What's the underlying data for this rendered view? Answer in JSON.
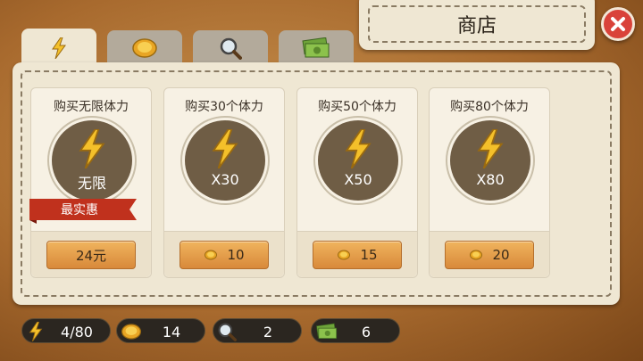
{
  "header": {
    "title": "商店"
  },
  "tabs": [
    {
      "icon": "lightning-icon",
      "active": true
    },
    {
      "icon": "coin-icon",
      "active": false
    },
    {
      "icon": "magnifier-icon",
      "active": false
    },
    {
      "icon": "cash-icon",
      "active": false
    }
  ],
  "cards": [
    {
      "title": "购买无限体力",
      "amount": "无限",
      "badge": "最实惠",
      "price": "24元",
      "price_icon": ""
    },
    {
      "title": "购买30个体力",
      "amount": "X30",
      "badge": "",
      "price": "10",
      "price_icon": "coin-icon"
    },
    {
      "title": "购买50个体力",
      "amount": "X50",
      "badge": "",
      "price": "15",
      "price_icon": "coin-icon"
    },
    {
      "title": "购买80个体力",
      "amount": "X80",
      "badge": "",
      "price": "20",
      "price_icon": "coin-icon"
    }
  ],
  "status_bar": [
    {
      "icon": "lightning-icon",
      "value": "4/80"
    },
    {
      "icon": "coin-icon",
      "value": "14"
    },
    {
      "icon": "magnifier-icon",
      "value": "2"
    },
    {
      "icon": "cash-icon",
      "value": "6"
    }
  ],
  "colors": {
    "accent": "#d8893a",
    "ribbon": "#c0311d",
    "close": "#d9423a",
    "medal": "#6f5d45"
  }
}
